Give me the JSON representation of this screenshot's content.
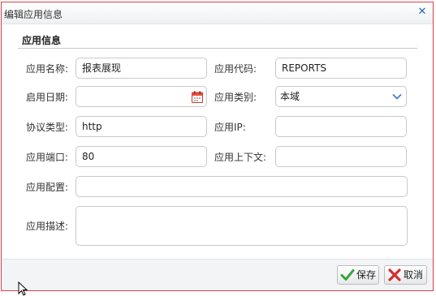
{
  "dialog": {
    "title": "编辑应用信息",
    "close_icon": "close-x-icon",
    "section_title": "应用信息"
  },
  "form": {
    "app_name": {
      "label": "应用名称:",
      "value": "报表展现"
    },
    "app_code": {
      "label": "应用代码:",
      "value": "REPORTS"
    },
    "start_date": {
      "label": "启用日期:",
      "value": "",
      "icon": "calendar-icon"
    },
    "app_type": {
      "label": "应用类别:",
      "value": "本域"
    },
    "protocol": {
      "label": "协议类型:",
      "value": "http"
    },
    "app_ip": {
      "label": "应用IP:",
      "value": ""
    },
    "app_port": {
      "label": "应用端口:",
      "value": "80"
    },
    "app_context": {
      "label": "应用上下文:",
      "value": ""
    },
    "app_config": {
      "label": "应用配置:",
      "value": ""
    },
    "app_desc": {
      "label": "应用描述:",
      "value": ""
    }
  },
  "footer": {
    "save_label": "保存",
    "cancel_label": "取消"
  },
  "colors": {
    "dialog_border": "#d9404a",
    "close_icon": "#1b6bb4",
    "save_check": "#3aa53a",
    "cancel_x": "#d32f2f"
  }
}
